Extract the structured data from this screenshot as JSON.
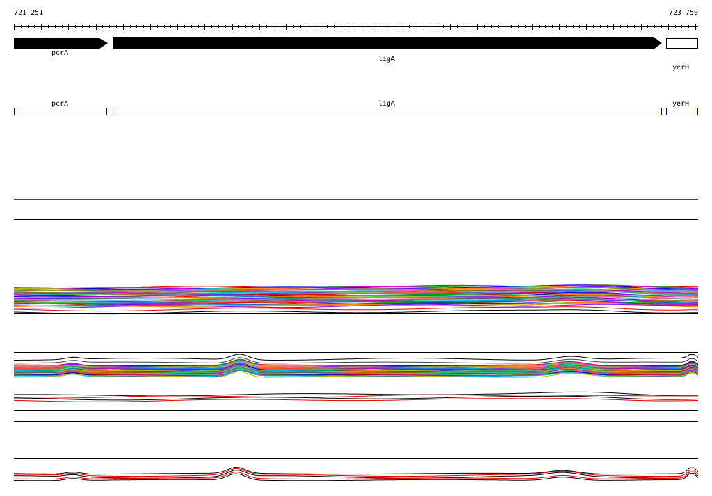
{
  "coordinates": {
    "start": "721 251",
    "end": "723 750"
  },
  "genes": [
    {
      "name": "pcrA",
      "strand": "+"
    },
    {
      "name": "ligA",
      "strand": "+"
    },
    {
      "name": "yerH",
      "strand": "+"
    }
  ],
  "annotation_track": [
    {
      "name": "pcrA"
    },
    {
      "name": "ligA"
    },
    {
      "name": "yerH"
    }
  ],
  "colors": {
    "gene_arrow": "#000000",
    "annotation_box": "#0000cc",
    "marker_line": "#e00000"
  }
}
